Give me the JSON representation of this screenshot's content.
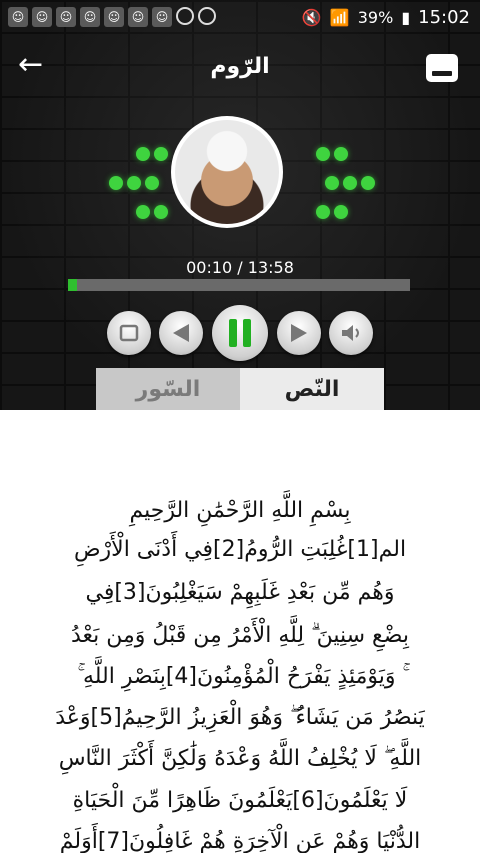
{
  "status_bar": {
    "time": "15:02",
    "battery": "39%"
  },
  "toolbar": {
    "title": "الرّوم"
  },
  "player": {
    "elapsed": "00:10 / 13:58",
    "progress_fraction": 0.026,
    "accent_color": "#2fbf2f"
  },
  "tabs": {
    "surahs": "السّور",
    "text": "النّص"
  },
  "verses": [
    "بِسْمِ اللَّهِ الرَّحْمَٰنِ الرَّحِيمِ",
    "الم[1]غُلِبَتِ الرُّومُ[2]فِي أَدْنَى الْأَرْضِ",
    "وَهُم مِّن بَعْدِ غَلَبِهِمْ سَيَغْلِبُونَ[3]فِي",
    "بِضْعِ سِنِينَ ۗ لِلَّهِ الْأَمْرُ مِن قَبْلُ وَمِن بَعْدُ",
    "ۚ وَيَوْمَئِذٍ يَفْرَحُ الْمُؤْمِنُونَ[4]بِنَصْرِ اللَّهِ ۚ",
    "يَنصُرُ مَن يَشَاءُ ۖ وَهُوَ الْعَزِيزُ الرَّحِيمُ[5]وَعْدَ",
    "اللَّهِ ۖ لَا يُخْلِفُ اللَّهُ وَعْدَهُ وَلَٰكِنَّ أَكْثَرَ النَّاسِ",
    "لَا يَعْلَمُونَ[6]يَعْلَمُونَ ظَاهِرًا مِّنَ الْحَيَاةِ",
    "الدُّنْيَا وَهُمْ عَنِ الْآخِرَةِ هُمْ غَافِلُونَ[7]أَوَلَمْ"
  ]
}
